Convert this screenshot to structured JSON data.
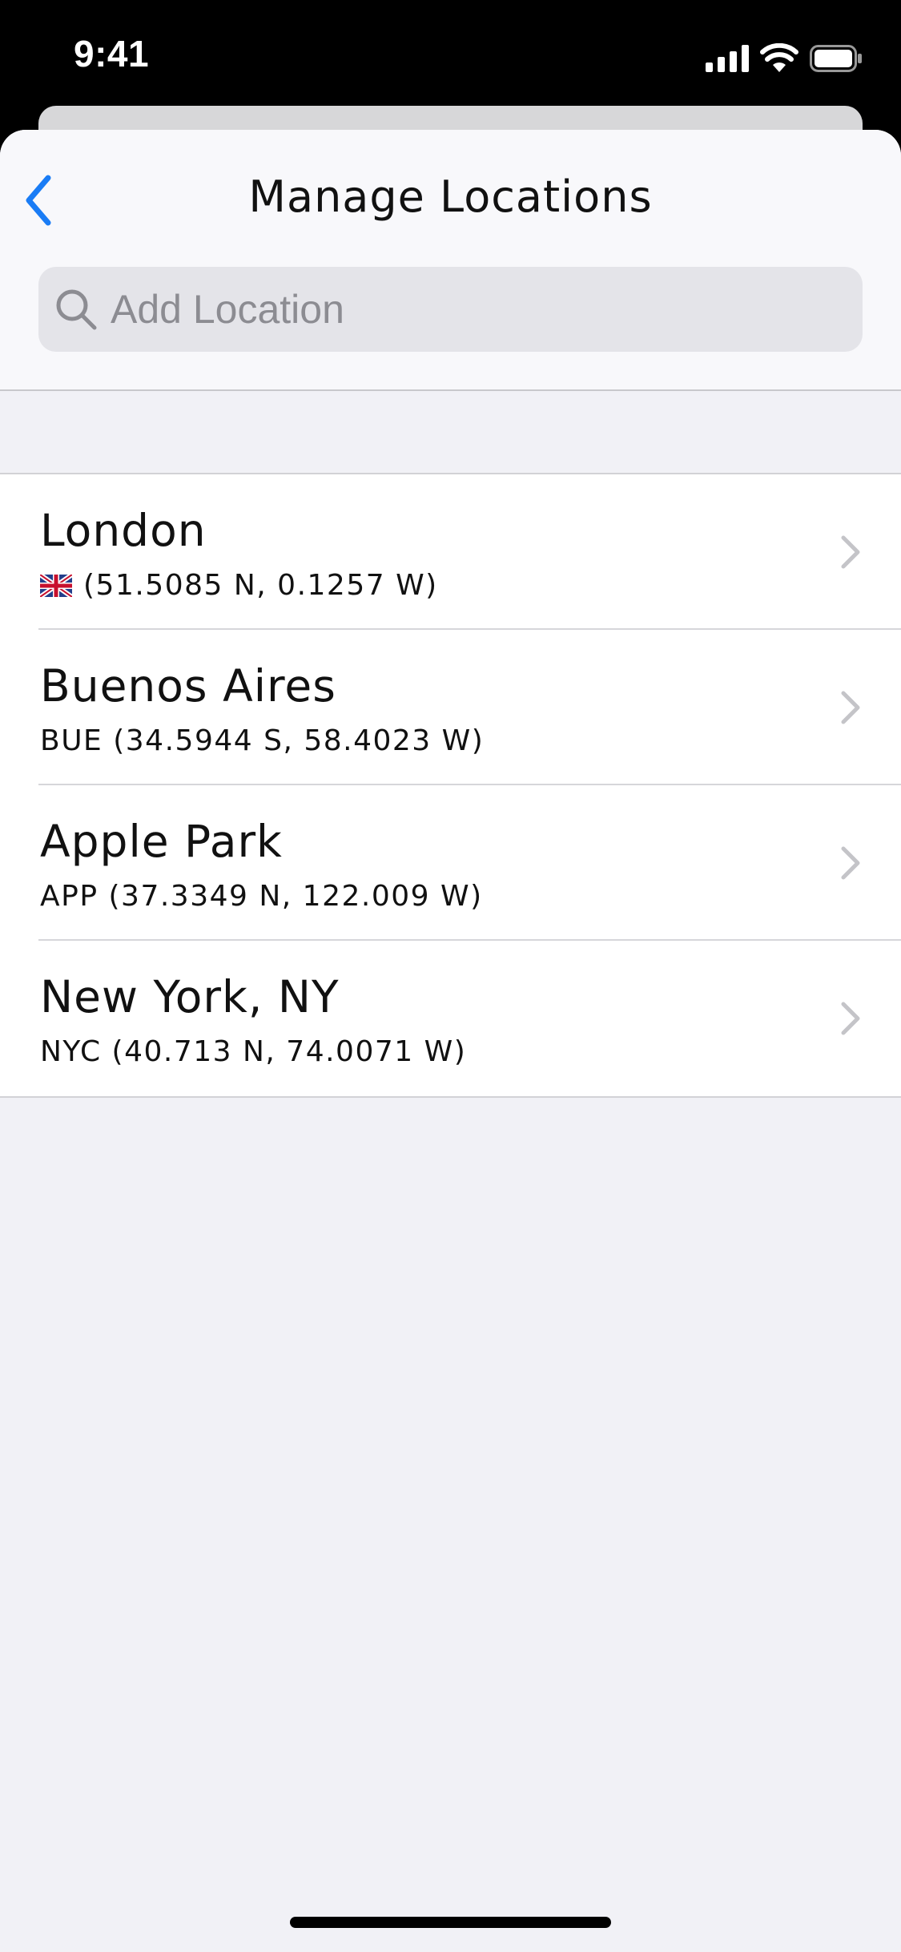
{
  "status_bar": {
    "time": "9:41",
    "icons": [
      "signal-icon",
      "wifi-icon",
      "battery-icon"
    ]
  },
  "header": {
    "title": "Manage Locations",
    "back_icon": "chevron-left-icon"
  },
  "search": {
    "placeholder": "Add Location",
    "value": "",
    "icon": "search-icon"
  },
  "locations": [
    {
      "name": "London",
      "detail": "(51.5085 N, 0.1257 W)",
      "flag": "uk-flag-icon"
    },
    {
      "name": "Buenos Aires",
      "detail": "BUE (34.5944 S, 58.4023 W)"
    },
    {
      "name": "Apple Park",
      "detail": "APP (37.3349 N, 122.009 W)"
    },
    {
      "name": "New York, NY",
      "detail": "NYC (40.713 N, 74.0071 W)"
    }
  ],
  "colors": {
    "accent": "#1a7cf5",
    "background": "#f1f1f6",
    "chevron": "#c4c4c8"
  }
}
